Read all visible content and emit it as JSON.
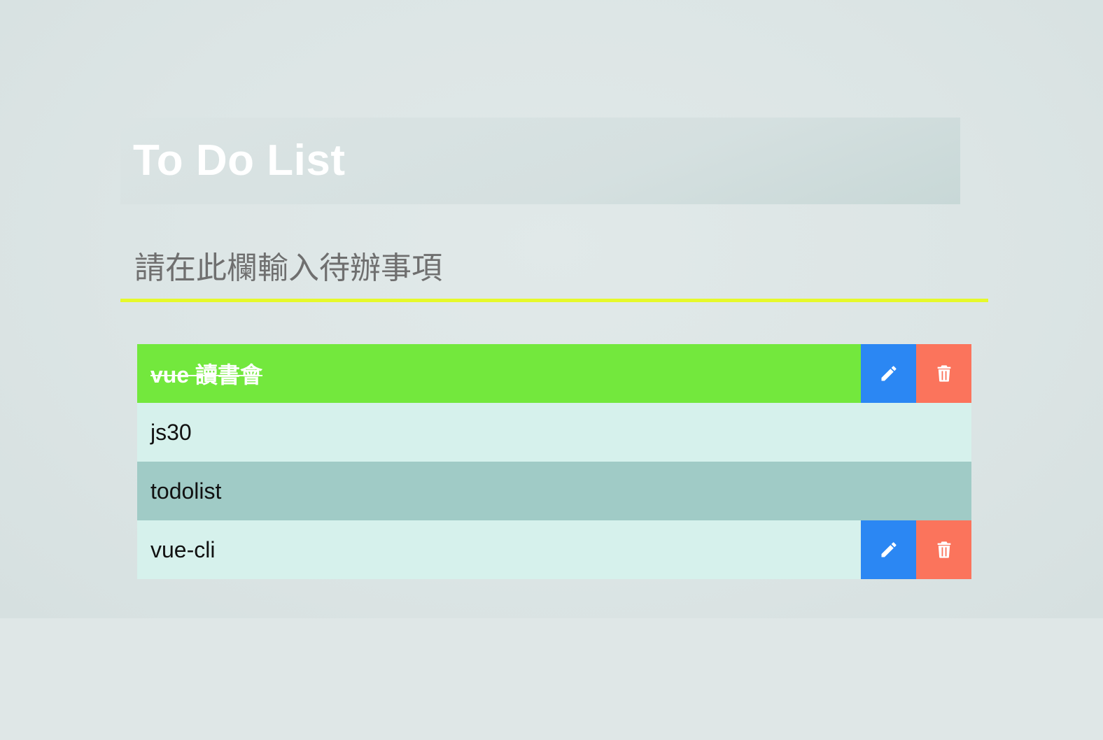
{
  "header": {
    "title": "To Do List"
  },
  "input": {
    "placeholder": "請在此欄輸入待辦事項",
    "value": ""
  },
  "todos": [
    {
      "text": "vue 讀書會",
      "state": "completed",
      "background": "#73e83d",
      "show_actions": true
    },
    {
      "text": "js30",
      "state": "normal",
      "background": "#d6f1ec",
      "show_actions": false
    },
    {
      "text": "todolist",
      "state": "hovered",
      "background": "#a0cbc6",
      "show_actions": false
    },
    {
      "text": "vue-cli",
      "state": "normal",
      "background": "#d6f1ec",
      "show_actions": true
    }
  ],
  "actions": {
    "edit_icon": "pencil-icon",
    "delete_icon": "trash-icon"
  },
  "colors": {
    "accent_underline": "#e6f92a",
    "edit_button": "#2b87f3",
    "delete_button": "#fb745c",
    "completed_row": "#73e83d",
    "row": "#d6f1ec",
    "row_highlight": "#a0cbc6",
    "title_text": "#ffffff"
  }
}
